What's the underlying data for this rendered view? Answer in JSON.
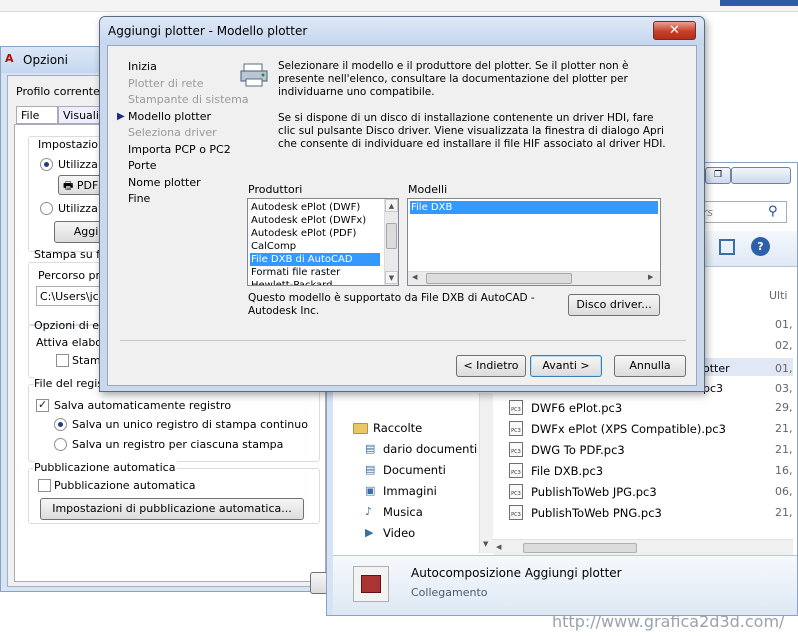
{
  "opzioni": {
    "title": "Opzioni",
    "profile_label": "Profilo corrente:",
    "tabs": [
      "File",
      "Visualizz"
    ],
    "group_plotter_settings": "Impostazioni di",
    "radio_use_printer": "Utilizza co",
    "device_value": "PDF(",
    "radio_use_other": "Utilizza im",
    "add_button": "Aggi",
    "group_print_file": "Stampa su file",
    "path_label": "Percorso pred",
    "path_value": "C:\\Users\\jcr\\",
    "group_processing": "Opzioni di elab",
    "active_processing": "Attiva elabora",
    "print_check": "Stamp",
    "group_log": "File del registr",
    "auto_save_log": "Salva automaticamente registro",
    "log_continuous": "Salva un unico registro di stampa continuo",
    "log_per_print": "Salva un registro per ciascuna stampa",
    "group_autopublish": "Pubblicazione automatica",
    "autopublish_check": "Pubblicazione automatica",
    "autopublish_settings": "Impostazioni di pubblicazione automatica..."
  },
  "dialog": {
    "title": "Aggiungi plotter - Modello plotter",
    "close_glyph": "✕",
    "steps": [
      {
        "label": "Inizia",
        "dim": false
      },
      {
        "label": "Plotter di rete",
        "dim": true
      },
      {
        "label": "Stampante di sistema",
        "dim": true
      },
      {
        "label": "Modello plotter",
        "dim": false,
        "current": true
      },
      {
        "label": "Seleziona driver",
        "dim": true
      },
      {
        "label": "Importa PCP o PC2",
        "dim": false
      },
      {
        "label": "Porte",
        "dim": false
      },
      {
        "label": "Nome plotter",
        "dim": false
      },
      {
        "label": "Fine",
        "dim": false
      }
    ],
    "intro_1": "Selezionare il modello e il produttore del plotter. Se il plotter non è presente nell'elenco, consultare la documentazione del plotter per individuarne uno compatibile.",
    "intro_2": "Se si dispone di un disco di installazione contenente un driver HDI, fare clic sul pulsante Disco driver. Viene visualizzata la finestra di dialogo Apri che consente di individuare ed installare il file HIF associato al driver HDI.",
    "manufacturers_label": "Produttori",
    "manufacturers": [
      "Autodesk ePlot (DWF)",
      "Autodesk ePlot (DWFx)",
      "Autodesk ePlot (PDF)",
      "CalComp",
      "File DXB di AutoCAD",
      "Formati file raster",
      "Hewlett-Packard"
    ],
    "manufacturers_selected": 4,
    "models_label": "Modelli",
    "models": [
      "File DXB"
    ],
    "models_selected": 0,
    "support_note": "Questo modello è supportato da File DXB di AutoCAD - Autodesk Inc.",
    "driver_disk_button": "Disco driver...",
    "back_button": "< Indietro",
    "next_button": "Avanti >",
    "cancel_button": "Annulla"
  },
  "explorer": {
    "search_placeholder": "ers",
    "column_header": "Ulti",
    "nav": [
      {
        "label": "Raccolte",
        "icon": "folder-icon"
      },
      {
        "label": "dario documenti",
        "icon": "document-icon"
      },
      {
        "label": "Documenti",
        "icon": "document-icon"
      },
      {
        "label": "Immagini",
        "icon": "image-icon"
      },
      {
        "label": "Musica",
        "icon": "music-icon"
      },
      {
        "label": "Video",
        "icon": "video-icon"
      }
    ],
    "partial_file_1": "otter",
    "partial_file_2": "pc3",
    "files": [
      {
        "name": "DWF6 ePlot.pc3",
        "date": "29,"
      },
      {
        "name": "DWFx ePlot (XPS Compatible).pc3",
        "date": "21,"
      },
      {
        "name": "DWG To PDF.pc3",
        "date": "21,"
      },
      {
        "name": "File DXB.pc3",
        "date": "16,"
      },
      {
        "name": "PublishToWeb JPG.pc3",
        "date": "06,"
      },
      {
        "name": "PublishToWeb PNG.pc3",
        "date": "21,"
      }
    ],
    "upper_dates": [
      "01,",
      "02,",
      "01,",
      "03,"
    ],
    "details_title": "Autocomposizione Aggiungi plotter",
    "details_type": "Collegamento"
  },
  "watermark": "http://www.grafica2d3d.com/"
}
